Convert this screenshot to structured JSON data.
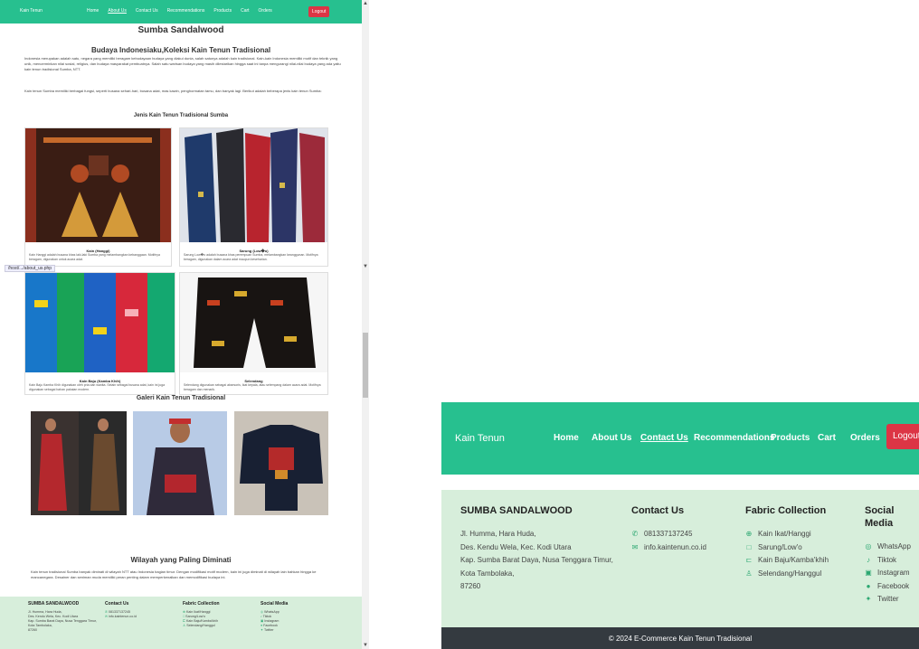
{
  "nav": {
    "brand": "Kain Tenun",
    "links": [
      "Home",
      "About Us",
      "Contact Us",
      "Recommendations",
      "Products",
      "Cart",
      "Orders"
    ],
    "logout": "Logout",
    "active_small": "About Us",
    "active_large": "Contact Us"
  },
  "page": {
    "title": "Sumba Sandalwood",
    "heading": "Budaya Indonesiaku,Koleksi Kain Tenun Tradisional",
    "para1": "Indonesia merupakan adalah satu, negara yang memiliki beragam kebudayaan budaya yang diakui dunia, salah satunya adalah kain tradisional. Kain-kain Indonesia memiliki motif dan teknik yang unik, mencerminkan nilai sosial, religius, dan budaya masyarakat pembuatnya. Salah satu warisan budaya yang masih dilestarikan hingga saat ini tanpa mengurangi nilai-nilai budaya yang ada yaitu kain tenun tradisional Sumba, NTT.",
    "para2": "Kain tenun Sumba memiliki berbagai fungsi, seperti busana sehari-hari, busana adat, mas kawin, penghormatan tamu, dan banyak lagi. Berikut adalah beberapa jenis kain tenun Sumba:",
    "jenis_heading": "Jenis Kain Tenun Tradisional Sumba",
    "cards": [
      {
        "title": "Kain (Hanggi)",
        "desc": "Kain Hanggi adalah busana khas laki-laki Sumba yang melambangkan kebanggaan. Motifnya beragam, digunakan untuk acara adat."
      },
      {
        "title": "Sarung (Low�o)",
        "desc": "Sarung Low�o adalah busana khas perempuan Sumba, melambangkan keanggunan. Motifnya beragam, digunakan dalam acara adat maupun keseharian."
      },
      {
        "title": "Kain Baju (Kamba Khih)",
        "desc": "Kain Baju Kamba Khih digunakan oleh pria dan wanita. Selain sebagai busana adat, kain ini juga digunakan sebagai bahan pakaian modern."
      },
      {
        "title": "Selendang",
        "desc": "Selendang digunakan sebagai aksesoris, ikat kepala, atau selempang dalam acara adat. Motifnya beragam dan menarik."
      }
    ],
    "status_url": "/host/.../about_us.php",
    "galeri_heading": "Galeri Kain Tenun Tradisional",
    "wilayah_heading": "Wilayah yang Paling Diminati",
    "wilayah_para": "Kain tenun tradisional Sumba banyak diminati di wilayah NTT atau Indonesia bagian timur. Dengan modifikasi motif modern, kain ini juga diminati di wilayah lain bahkan hingga ke mancanegara. Desainer dan seniman muda memiliki peran penting dalam memperkenalkan dan memodifikasi budaya ini."
  },
  "footer": {
    "brand_title": "SUMBA SANDALWOOD",
    "address_lines": [
      "Jl. Humma, Hara Huda,",
      "Des. Kendu Wela, Kec. Kodi Utara",
      "Kap. Sumba Barat Daya, Nusa Tenggara Timur,",
      "Kota Tambolaka,",
      "87260"
    ],
    "contact_title": "Contact Us",
    "contact_items": [
      {
        "icon": "phone-icon",
        "text": "081337137245"
      },
      {
        "icon": "email-icon",
        "text": "info.kaintenun.co.id"
      }
    ],
    "fabric_title": "Fabric Collection",
    "fabric_items": [
      {
        "icon": "globe-icon",
        "text": "Kain Ikat/Hanggi"
      },
      {
        "icon": "square-icon",
        "text": "Sarung/Low'o"
      },
      {
        "icon": "bracket-icon",
        "text": "Kain Baju/Kamba'khih"
      },
      {
        "icon": "person-icon",
        "text": "Selendang/Hanggul"
      }
    ],
    "social_title": "Social Media",
    "social_items": [
      {
        "icon": "whatsapp-icon",
        "text": "WhatsApp"
      },
      {
        "icon": "tiktok-icon",
        "text": "Tiktok"
      },
      {
        "icon": "instagram-icon",
        "text": "Instagram"
      },
      {
        "icon": "facebook-icon",
        "text": "Facebook"
      },
      {
        "icon": "twitter-icon",
        "text": "Twitter"
      }
    ],
    "copyright": "© 2024 E-Commerce Kain Tenun Tradisional"
  },
  "colors": {
    "nav_bg": "#27c08f",
    "logout_bg": "#dc3545",
    "footer_bg": "#d7eedb",
    "copyright_bg": "#343a40",
    "icon_green": "#2ba771"
  }
}
